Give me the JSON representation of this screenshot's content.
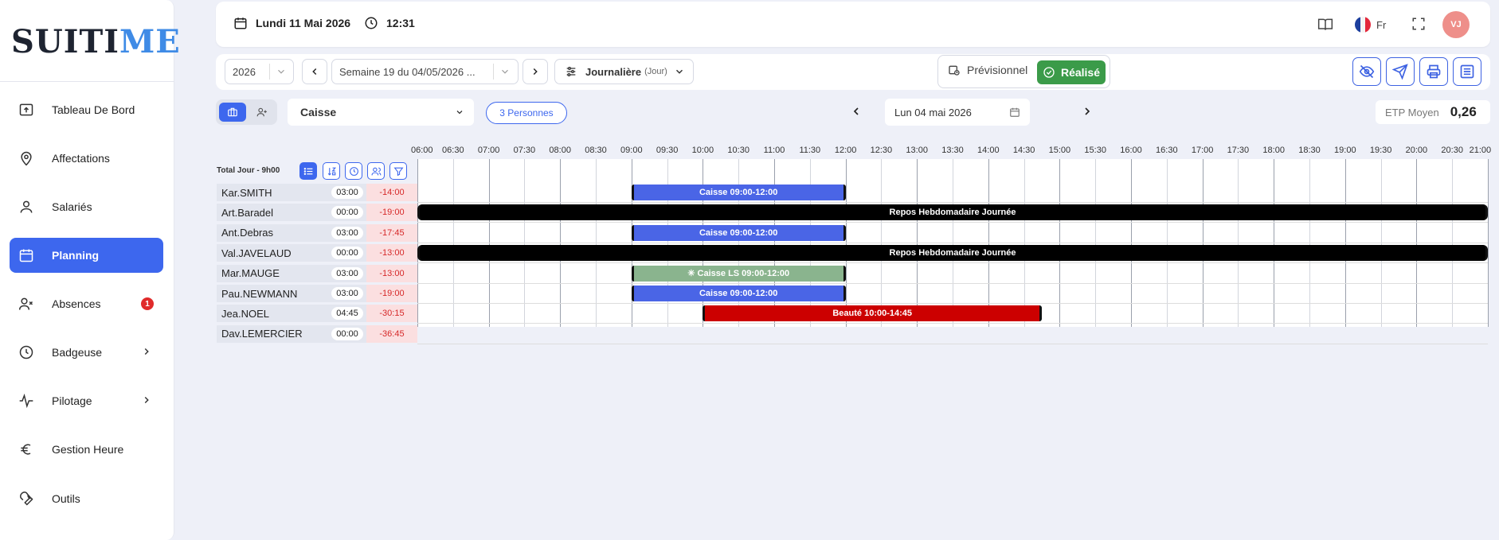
{
  "logo": {
    "part1": "SUI",
    "part2": "T",
    "part3": "I",
    "part4": "ME"
  },
  "nav": [
    {
      "label": "Tableau De Bord",
      "icon": "dashboard-upload-icon",
      "name": "tableau-de-bord"
    },
    {
      "label": "Affectations",
      "icon": "location-pin-icon",
      "name": "affectations"
    },
    {
      "label": "Salariés",
      "icon": "user-icon",
      "name": "salaries"
    },
    {
      "label": "Planning",
      "icon": "calendar-icon",
      "name": "planning",
      "active": true
    },
    {
      "label": "Absences",
      "icon": "user-x-icon",
      "name": "absences",
      "badge": "1"
    },
    {
      "label": "Badgeuse",
      "icon": "clock-icon",
      "name": "badgeuse",
      "chevron": true
    },
    {
      "label": "Pilotage",
      "icon": "activity-icon",
      "name": "pilotage",
      "chevron": true
    },
    {
      "label": "Gestion Heure",
      "icon": "euro-icon",
      "name": "gestion-heure"
    },
    {
      "label": "Outils",
      "icon": "wrench-icon",
      "name": "outils"
    }
  ],
  "topbar": {
    "date": "Lundi 11 Mai 2026",
    "time": "12:31",
    "language": "Fr",
    "avatar": "VJ"
  },
  "toolbar": {
    "year": "2026",
    "week": "Semaine 19 du 04/05/2026 ...",
    "view": "Journalière",
    "view_sub": "(Jour)",
    "mode_previsional": "Prévisionnel",
    "mode_realise": "Réalisé"
  },
  "filters": {
    "team": "Caisse",
    "persons": "3 Personnes",
    "day": "Lun 04 mai 2026",
    "etp_label": "ETP Moyen",
    "etp_value": "0,26"
  },
  "grid": {
    "total_label": "Total Jour - 9h00",
    "times": [
      "06:00",
      "06:30",
      "07:00",
      "07:30",
      "08:00",
      "08:30",
      "09:00",
      "09:30",
      "10:00",
      "10:30",
      "11:00",
      "11:30",
      "12:00",
      "12:30",
      "13:00",
      "13:30",
      "14:00",
      "14:30",
      "15:00",
      "15:30",
      "16:00",
      "16:30",
      "17:00",
      "17:30",
      "18:00",
      "18:30",
      "19:00",
      "19:30",
      "20:00",
      "20:30",
      "21:00"
    ],
    "rows": [
      {
        "name": "Kar.SMITH",
        "hours": "03:00",
        "delta": "-14:00",
        "shift": {
          "label": "Caisse 09:00-12:00",
          "start": "09:00",
          "end": "12:00",
          "color": "#4a65e6"
        }
      },
      {
        "name": "Art.Baradel",
        "hours": "00:00",
        "delta": "-19:00",
        "shift": {
          "label": "Repos Hebdomadaire Journée",
          "start": "06:00",
          "end": "21:00",
          "color": "#000000"
        }
      },
      {
        "name": "Ant.Debras",
        "hours": "03:00",
        "delta": "-17:45",
        "shift": {
          "label": "Caisse 09:00-12:00",
          "start": "09:00",
          "end": "12:00",
          "color": "#4a65e6"
        }
      },
      {
        "name": "Val.JAVELAUD",
        "hours": "00:00",
        "delta": "-13:00",
        "shift": {
          "label": "Repos Hebdomadaire Journée",
          "start": "06:00",
          "end": "21:00",
          "color": "#000000"
        }
      },
      {
        "name": "Mar.MAUGE",
        "hours": "03:00",
        "delta": "-13:00",
        "shift": {
          "label": "✳ Caisse LS 09:00-12:00",
          "start": "09:00",
          "end": "12:00",
          "color": "#8ab48e"
        }
      },
      {
        "name": "Pau.NEWMANN",
        "hours": "03:00",
        "delta": "-19:00",
        "shift": {
          "label": "Caisse 09:00-12:00",
          "start": "09:00",
          "end": "12:00",
          "color": "#4a65e6"
        }
      },
      {
        "name": "Jea.NOEL",
        "hours": "04:45",
        "delta": "-30:15",
        "shift": {
          "label": "Beauté 10:00-14:45",
          "start": "10:00",
          "end": "14:45",
          "color": "#cc0000"
        }
      },
      {
        "name": "Dav.LEMERCIER",
        "hours": "00:00",
        "delta": "-36:45"
      }
    ]
  }
}
